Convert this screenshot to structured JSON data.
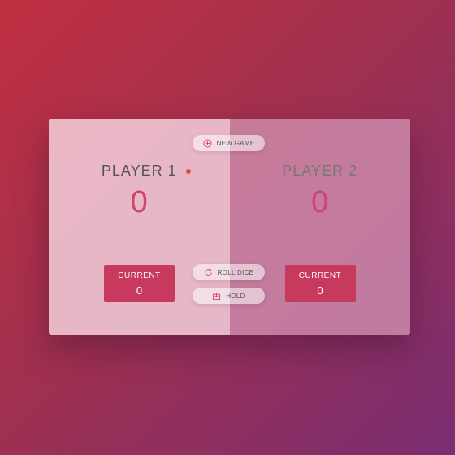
{
  "game": {
    "players": [
      {
        "name": "PLAYER 1",
        "score": "0",
        "current_label": "CURRENT",
        "current": "0",
        "active": true
      },
      {
        "name": "PLAYER 2",
        "score": "0",
        "current_label": "CURRENT",
        "current": "0",
        "active": false
      }
    ],
    "buttons": {
      "new_game": "NEW GAME",
      "roll_dice": "ROLL DICE",
      "hold": "HOLD"
    },
    "icons": {
      "new_game": "plus-circle-icon",
      "roll_dice": "refresh-icon",
      "hold": "download-tray-icon"
    }
  },
  "colors": {
    "accent": "#c8395e",
    "score": "#d0436f",
    "active_dot": "#e04a4a"
  }
}
